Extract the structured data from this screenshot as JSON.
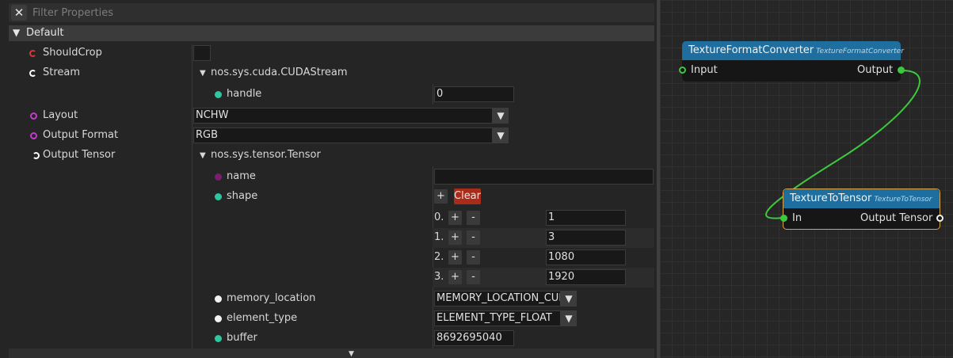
{
  "filter": {
    "placeholder": "Filter Properties",
    "close_icon": "✕"
  },
  "section": {
    "label": "Default",
    "expanded_icon": "▼"
  },
  "properties": {
    "should_crop": {
      "label": "ShouldCrop"
    },
    "stream": {
      "label": "Stream",
      "type_label": "nos.sys.cuda.CUDAStream",
      "handle": {
        "label": "handle",
        "value": "0"
      }
    },
    "layout": {
      "label": "Layout",
      "value": "NCHW"
    },
    "output_format": {
      "label": "Output Format",
      "value": "RGB"
    },
    "output_tensor": {
      "label": "Output Tensor",
      "type_label": "nos.sys.tensor.Tensor",
      "name": {
        "label": "name",
        "value": ""
      },
      "shape": {
        "label": "shape",
        "add_label": "+",
        "clear_label": "Clear",
        "items": [
          {
            "index": "0.",
            "value": "1"
          },
          {
            "index": "1.",
            "value": "3"
          },
          {
            "index": "2.",
            "value": "1080"
          },
          {
            "index": "3.",
            "value": "1920"
          }
        ]
      },
      "memory_location": {
        "label": "memory_location",
        "value": "MEMORY_LOCATION_CUDA"
      },
      "element_type": {
        "label": "element_type",
        "value": "ELEMENT_TYPE_FLOAT"
      },
      "buffer": {
        "label": "buffer",
        "value": "8692695040"
      }
    }
  },
  "controls": {
    "plus": "+",
    "minus": "-",
    "dropdown_icon": "▼",
    "tree_expanded_icon": "▼",
    "scroll_down_icon": "▼"
  },
  "graph": {
    "node1": {
      "title": "TextureFormatConverter",
      "subtitle": "TextureFormatConverter",
      "input_label": "Input",
      "output_label": "Output",
      "title_color": "#1e6f9f"
    },
    "node2": {
      "title": "TextureToTensor",
      "subtitle": "TextureToTensor",
      "input_label": "In",
      "output_label": "Output Tensor",
      "title_color": "#1e6f9f",
      "border_color": "#d8a34a"
    },
    "link_color": "#3ec83e"
  }
}
